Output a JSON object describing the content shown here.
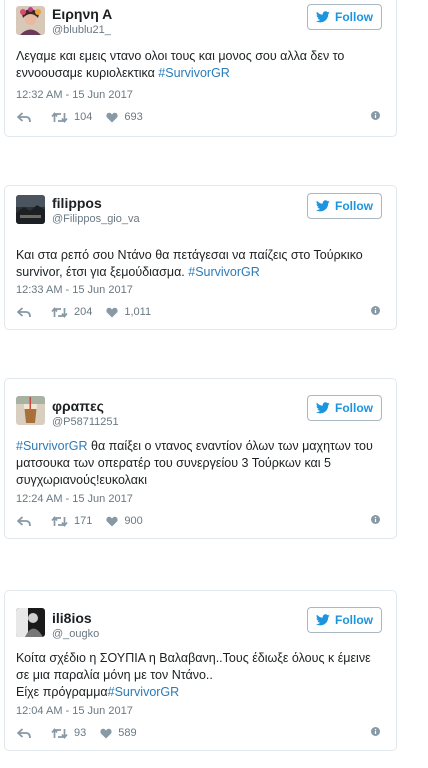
{
  "follow_label": "Follow",
  "accent_color": "#1b95e0",
  "tweets": [
    {
      "name": "Ειρηνη Α",
      "handle": "@blublu21_",
      "text_before": "Λεγαμε και εμεις ντανο ολοι τους και μονος σου αλλα δεν το εννοουσαμε κυριολεκτικα ",
      "hashtag": "#SurvivorGR",
      "text_between": "",
      "text_after": "",
      "date": "12:32 AM - 15 Jun 2017",
      "retweets": "104",
      "likes": "693",
      "avatar": "portrait-with-flowers"
    },
    {
      "name": "filippos",
      "handle": "@Filippos_gio_va",
      "text_before": "Και στα ρεπό σου Ντάνο θα πετάγεσαι να παίζεις στο Τούρκικο survivor, έτσι για ξεμούδιασμα. ",
      "hashtag": "#SurvivorGR",
      "text_between": "",
      "text_after": "",
      "date": "12:33 AM - 15 Jun 2017",
      "retweets": "204",
      "likes": "1,011",
      "avatar": "landscape-dark"
    },
    {
      "name": "φραπες",
      "handle": "@P58711251",
      "text_before": "",
      "hashtag": "#SurvivorGR",
      "text_between": " θα παίξει ο ντανος εναντίον όλων των μαχητων του",
      "text_after": "ματσουκα των οπερατέρ του συνεργείου 3 Τούρκων και 5 συγχωριανούς!ευκολακι",
      "date": "12:24 AM - 15 Jun 2017",
      "retweets": "171",
      "likes": "900",
      "avatar": "frappe-cup"
    },
    {
      "name": "ili8ios",
      "handle": "@_ougko",
      "text_before": "Κοίτα σχέδιο η ΣΟΥΠΙΑ η Βαλαβανη..Τους έδιωξε όλους κ έμεινε σε μια παραλία μόνη με τον Ντάνο..",
      "text_line2": "Είχε πρόγραμμα",
      "hashtag": "#SurvivorGR",
      "text_between": "",
      "text_after": "",
      "date": "12:04 AM - 15 Jun 2017",
      "retweets": "93",
      "likes": "589",
      "avatar": "black-white-figure"
    }
  ]
}
